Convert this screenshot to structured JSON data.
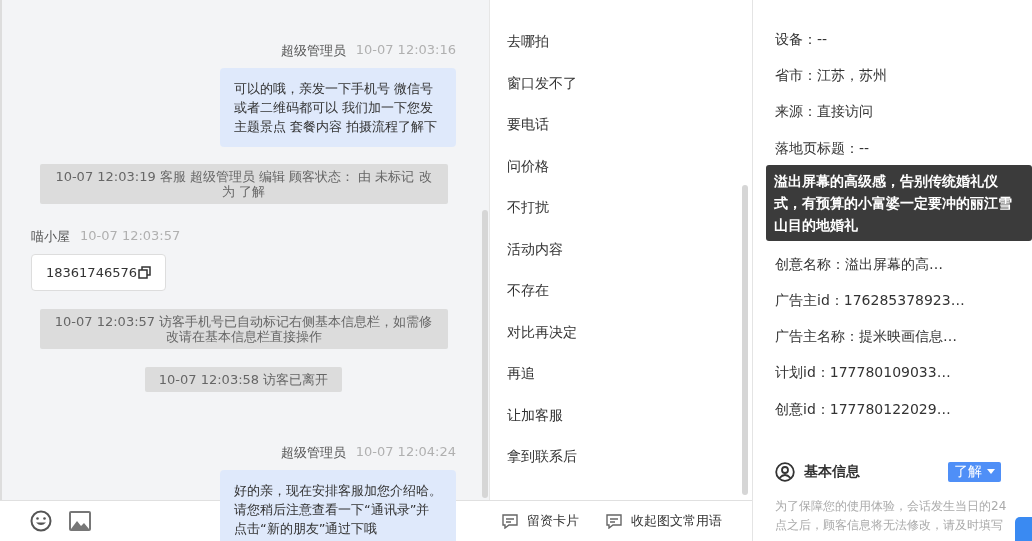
{
  "chat": {
    "messages": [
      {
        "kind": "outgoing",
        "sender": "超级管理员",
        "time": "10-07 12:03:16",
        "text": "可以的哦，亲发一下手机号 微信号或者二维码都可以 我们加一下您发主题景点 套餐内容 拍摄流程了解下"
      },
      {
        "kind": "system",
        "text": "10-07 12:03:19 客服 超级管理员 编辑 顾客状态： 由 未标记 改为 了解"
      },
      {
        "kind": "incoming",
        "sender": "喵小屋",
        "time": "10-07 12:03:57",
        "card": "18361746576"
      },
      {
        "kind": "system",
        "text": "10-07 12:03:57 访客手机号已自动标记右侧基本信息栏，如需修改请在基本信息栏直接操作"
      },
      {
        "kind": "system",
        "text": "10-07 12:03:58 访客已离开"
      },
      {
        "kind": "outgoing",
        "sender": "超级管理员",
        "time": "10-07 12:04:24",
        "text": "好的亲，现在安排客服加您介绍哈。请您稍后注意查看一下“通讯录”并点击“新的朋友”通过下哦"
      }
    ]
  },
  "quick_replies": [
    "去哪拍",
    "窗口发不了",
    "要电话",
    "问价格",
    "不打扰",
    "活动内容",
    "不存在",
    "对比再决定",
    "再追",
    "让加客服",
    "拿到联系后"
  ],
  "toolbar": {
    "buttons": [
      "留资卡片",
      "收起图文常用语"
    ]
  },
  "source_info": {
    "rows": [
      {
        "kind": "row",
        "label": "设备：",
        "value": "--"
      },
      {
        "kind": "row",
        "label": "省市：",
        "value": "江苏，苏州"
      },
      {
        "kind": "row",
        "label": "来源：",
        "value": "直接访问"
      },
      {
        "kind": "row",
        "label": "落地页标题：",
        "value": "--"
      },
      {
        "kind": "tooltip",
        "text": "溢出屏幕的高级感，告别传统婚礼仪式，有预算的小富婆一定要冲的丽江雪山目的地婚礼"
      },
      {
        "kind": "row",
        "label": "创意名称：",
        "value": "溢出屏幕的高…"
      },
      {
        "kind": "row",
        "label": "广告主id：",
        "value": "176285378923…"
      },
      {
        "kind": "row",
        "label": "广告主名称：",
        "value": "提米映画信息…"
      },
      {
        "kind": "row",
        "label": "计划id：",
        "value": "177780109033…"
      },
      {
        "kind": "row",
        "label": "创意id：",
        "value": "177780122029…"
      }
    ]
  },
  "basic_info": {
    "title": "基本信息",
    "status": "了解",
    "note": "为了保障您的使用体验，会话发生当日的24点之后，顾客信息将无法修改，请及时填写"
  }
}
